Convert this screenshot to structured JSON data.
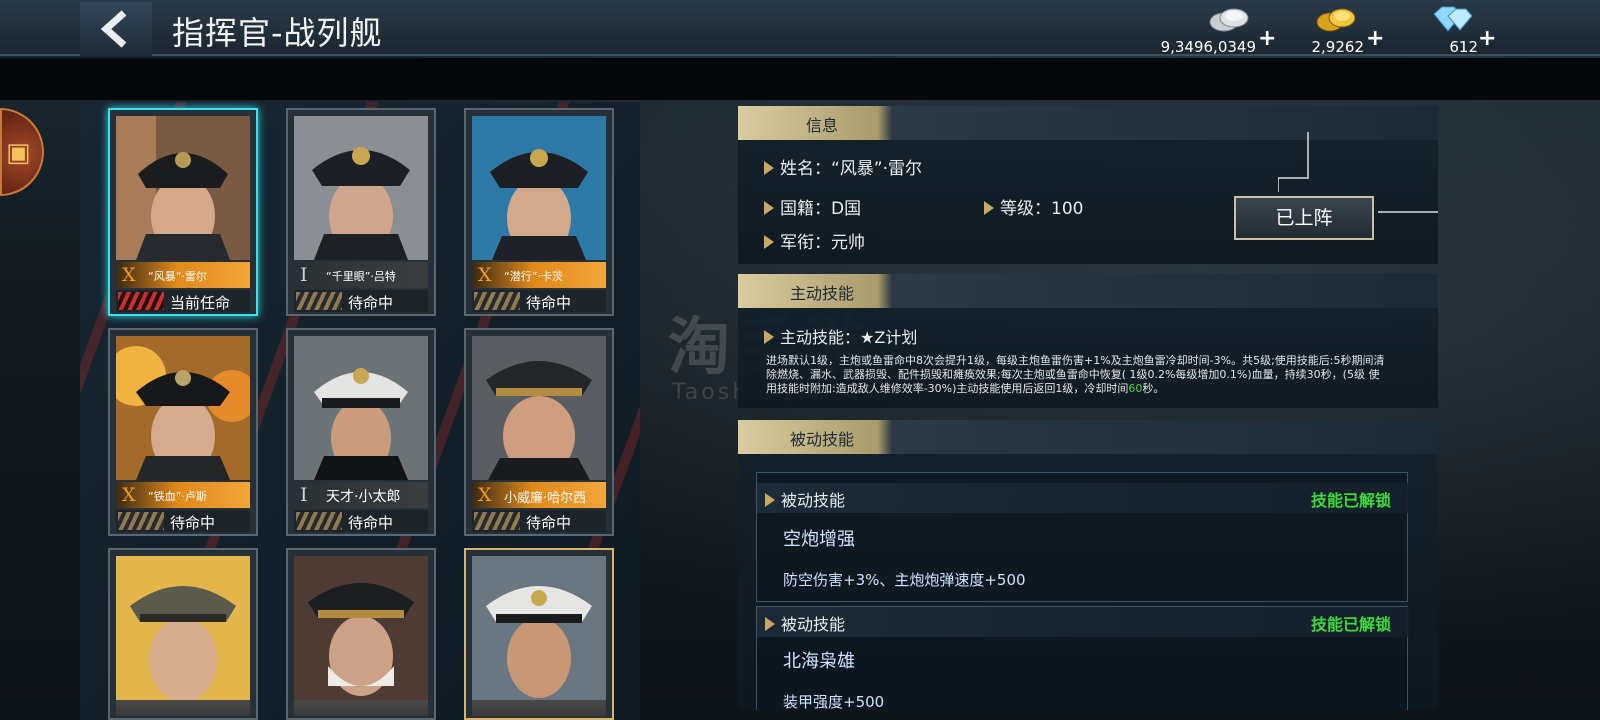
{
  "header": {
    "title": "指挥官-战列舰",
    "resources": [
      {
        "name": "silver-coins",
        "value": "9,3496,0349",
        "plus": "+"
      },
      {
        "name": "gold-coins",
        "value": "2,9262",
        "plus": "+"
      },
      {
        "name": "diamonds",
        "value": "612",
        "plus": "+"
      }
    ]
  },
  "commanders": [
    {
      "rank": "X",
      "name": "“风暴”·雷尔",
      "status": "当前任命",
      "selected": true
    },
    {
      "rank": "I",
      "name": "“千里眼”·吕特",
      "status": "待命中"
    },
    {
      "rank": "X",
      "name": "“潜行”·卡茨",
      "status": "待命中"
    },
    {
      "rank": "X",
      "name": "“铁血”·卢斯",
      "status": "待命中"
    },
    {
      "rank": "I",
      "name": "天才·小太郎",
      "status": "待命中"
    },
    {
      "rank": "X",
      "name": "小威廉·哈尔西",
      "status": "待命中"
    },
    {
      "rank": "",
      "name": "",
      "status": ""
    },
    {
      "rank": "",
      "name": "",
      "status": ""
    },
    {
      "rank": "",
      "name": "",
      "status": ""
    }
  ],
  "info": {
    "section_label": "信息",
    "name_label": "姓名：",
    "name_value": "“风暴”·雷尔",
    "nationality_label": "国籍：",
    "nationality_value": "D国",
    "level_label": "等级：",
    "level_value": "100",
    "rank_label": "军衔：",
    "rank_value": "元帅",
    "deploy_button": "已上阵"
  },
  "active_skill": {
    "section_label": "主动技能",
    "label": "主动技能：",
    "value": "★Z计划",
    "description_part1": "进场默认1级，主炮或鱼雷命中8次会提升1级，每级主炮鱼雷伤害+1%及主炮鱼雷冷却时间-3%。共5级;使用技能后:5秒期间清除燃烧、漏水、武器损毁、配件损毁和瘫痪效果;每次主炮或鱼雷命中恢复( 1级0.2%每级增加0.1%)血量，持续30秒，(5级 使用技能时附加:造成敌人维修效率-30%)主动技能使用后返回1级，冷却时间",
    "description_highlight": "60",
    "description_part2": "秒。"
  },
  "passive_skills": {
    "section_label": "被动技能",
    "items": [
      {
        "label": "被动技能",
        "status": "技能已解锁",
        "name": "空炮增强",
        "effect": "防空伤害+3%、主炮炮弹速度+500"
      },
      {
        "label": "被动技能",
        "status": "技能已解锁",
        "name": "北海枭雄",
        "effect": "装甲强度+500"
      }
    ]
  },
  "watermark": {
    "cn": "淘手游",
    "en": "Taoshouyou.Com"
  },
  "colors": {
    "accent_cyan": "#3ee0ea",
    "gold": "#c8a862",
    "unlock_green": "#3fd83f"
  }
}
